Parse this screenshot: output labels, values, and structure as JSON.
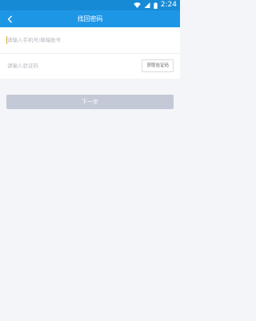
{
  "status_bar": {
    "time": "2:24",
    "icons": [
      "wifi-icon",
      "signal-icon",
      "battery-icon"
    ]
  },
  "header": {
    "title": "找回密码",
    "back_icon": "chevron-left-icon"
  },
  "form": {
    "account_placeholder": "请输入手机号/邮箱账号",
    "code_placeholder": "请输入验证码",
    "get_code_label": "获取验证码"
  },
  "next_button": {
    "label": "下一步"
  },
  "colors": {
    "primary": "#1e96e6",
    "statusbar": "#178ad6",
    "disabled_button": "#c3c9d6",
    "background": "#f4f5f8"
  }
}
